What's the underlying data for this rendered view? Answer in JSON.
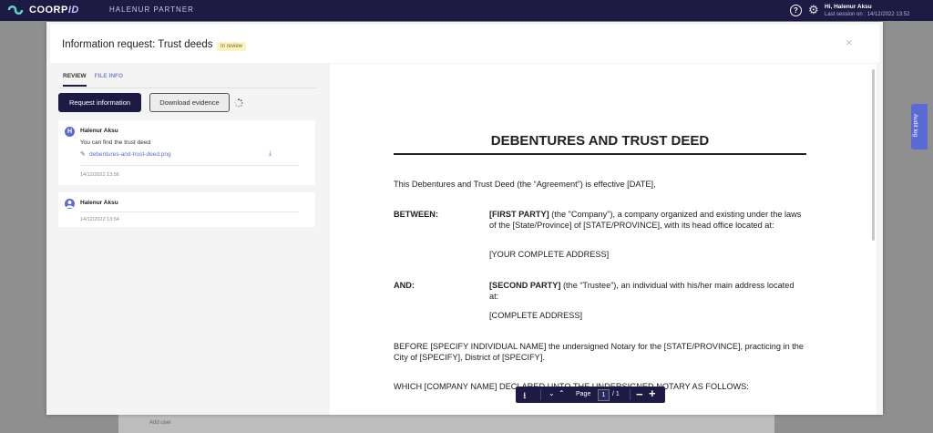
{
  "topbar": {
    "logo_text": "COORP",
    "logo_suffix": "ID",
    "partner_label": "HALENUR PARTNER",
    "help_icon": "help-icon",
    "settings_icon": "gear-icon",
    "user_greeting": "Hi, Halenur Aksu",
    "last_session": "Last session on : 14/12/2022 13:52"
  },
  "side_tab": {
    "label": "Audit log"
  },
  "background": {
    "row_text": "Add user"
  },
  "modal": {
    "title": "Information request: Trust deeds",
    "status_badge": "In review",
    "close_label": "×"
  },
  "left_panel": {
    "tabs": [
      {
        "label": "REVIEW"
      },
      {
        "label": "FILE INFO"
      }
    ],
    "request_button": "Request information",
    "download_button": "Download evidence",
    "messages": [
      {
        "avatar_initial": "H",
        "author": "Halenur Aksu",
        "text": "You can find the trust deed",
        "attachment": "debentures-and-trust-deed.png",
        "timestamp": "14/12/2022 13:56"
      },
      {
        "avatar_initial": "",
        "author": "Halenur Aksu",
        "timestamp": "14/12/2022 13:54"
      }
    ]
  },
  "document": {
    "title": "DEBENTURES AND TRUST DEED",
    "intro": "This Debentures and Trust Deed (the “Agreement”) is effective [DATE],",
    "between_label": "BETWEEN:",
    "first_party_bold": "[FIRST PARTY]",
    "first_party_text": " (the \"Company\"), a company organized and existing under the laws of the [State/Province] of [STATE/PROVINCE], with its head office located at:",
    "first_party_address": "[YOUR COMPLETE ADDRESS]",
    "and_label": "AND:",
    "second_party_bold": "[SECOND PARTY]",
    "second_party_text": " (the “Trustee”), an individual with his/her main address located at:",
    "second_party_address": "[COMPLETE ADDRESS]",
    "before_text": "BEFORE [SPECIFY INDIVIDUAL NAME] the undersigned Notary for the [STATE/PROVINCE], practicing in the City of [SPECIFY], District of [SPECIFY].",
    "whichtext": "WHICH [COMPANY NAME] DECLARED UNTO THE UNDERSIGNED NOTARY AS FOLLOWS:"
  },
  "viewer_toolbar": {
    "page_label": "Page",
    "current_page": "1",
    "total_pages": "/ 1"
  },
  "colors": {
    "brand_dark": "#1d1b44",
    "accent": "#5b6bd6",
    "badge_bg": "#fbf3c2"
  }
}
